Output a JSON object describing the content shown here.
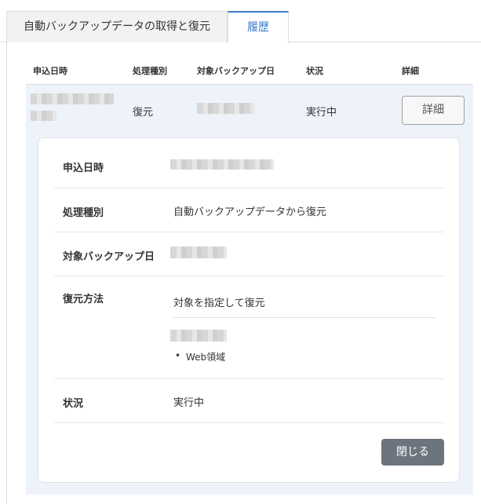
{
  "tabs": [
    {
      "label": "自動バックアップデータの取得と復元"
    },
    {
      "label": "履歴"
    }
  ],
  "table": {
    "headers": [
      "申込日時",
      "処理種別",
      "対象バックアップ日",
      "状況",
      "詳細"
    ],
    "row": {
      "type": "復元",
      "status": "実行中",
      "detail_button": "詳細"
    }
  },
  "detail": {
    "fields": [
      {
        "label": "申込日時"
      },
      {
        "label": "処理種別",
        "value": "自動バックアップデータから復元"
      },
      {
        "label": "対象バックアップ日"
      },
      {
        "label": "復元方法",
        "value": "対象を指定して復元",
        "items": [
          "Web領域"
        ]
      },
      {
        "label": "状況",
        "value": "実行中"
      }
    ],
    "close_button": "閉じる"
  }
}
